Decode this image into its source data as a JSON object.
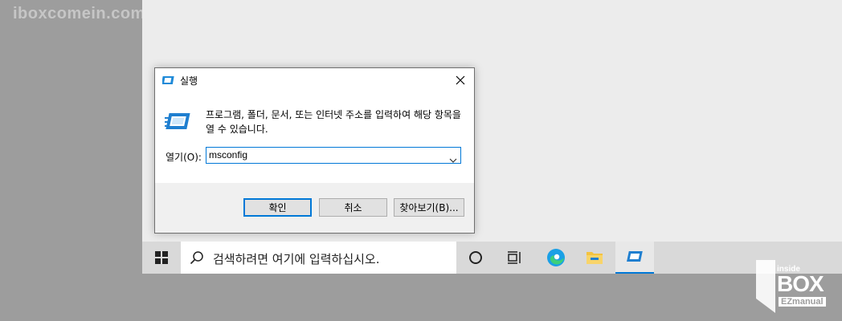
{
  "watermark": "iboxcomein.com",
  "dialog": {
    "title": "실행",
    "description": "프로그램, 폴더, 문서, 또는 인터넷 주소를 입력하여 해당 항목을 열 수 있습니다.",
    "open_label": "열기(O):",
    "open_value": "msconfig",
    "ok_label": "확인",
    "cancel_label": "취소",
    "browse_label": "찾아보기(B)..."
  },
  "taskbar": {
    "search_placeholder": "검색하려면 여기에 입력하십시오."
  },
  "logo": {
    "small": "inside",
    "big": "BOX",
    "sub": "EZmanual"
  },
  "colors": {
    "accent": "#0078d7",
    "folder": "#f4c33f",
    "edge": "#1aa0e6"
  }
}
